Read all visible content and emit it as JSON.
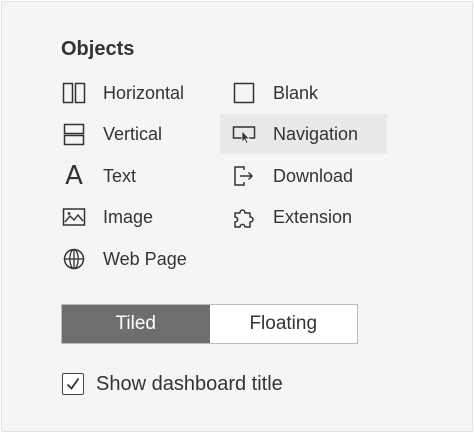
{
  "objects_panel": {
    "title": "Objects",
    "items": [
      {
        "label": "Horizontal",
        "icon": "horizontal-container-icon"
      },
      {
        "label": "Vertical",
        "icon": "vertical-container-icon"
      },
      {
        "label": "Text",
        "icon": "text-icon",
        "glyph": "A"
      },
      {
        "label": "Image",
        "icon": "image-icon"
      },
      {
        "label": "Web Page",
        "icon": "globe-icon"
      },
      {
        "label": "Blank",
        "icon": "blank-icon"
      },
      {
        "label": "Navigation",
        "icon": "navigation-icon",
        "selected": true
      },
      {
        "label": "Download",
        "icon": "download-icon"
      },
      {
        "label": "Extension",
        "icon": "puzzle-icon"
      }
    ]
  },
  "layout_toggle": {
    "options": [
      "Tiled",
      "Floating"
    ],
    "selected": "Tiled"
  },
  "show_title": {
    "label": "Show dashboard title",
    "checked": true
  },
  "colors": {
    "panel_bg": "#f5f5f5",
    "text": "#333333",
    "selected_bg": "#e9e9e9",
    "toggle_active": "#6e6e6e"
  }
}
